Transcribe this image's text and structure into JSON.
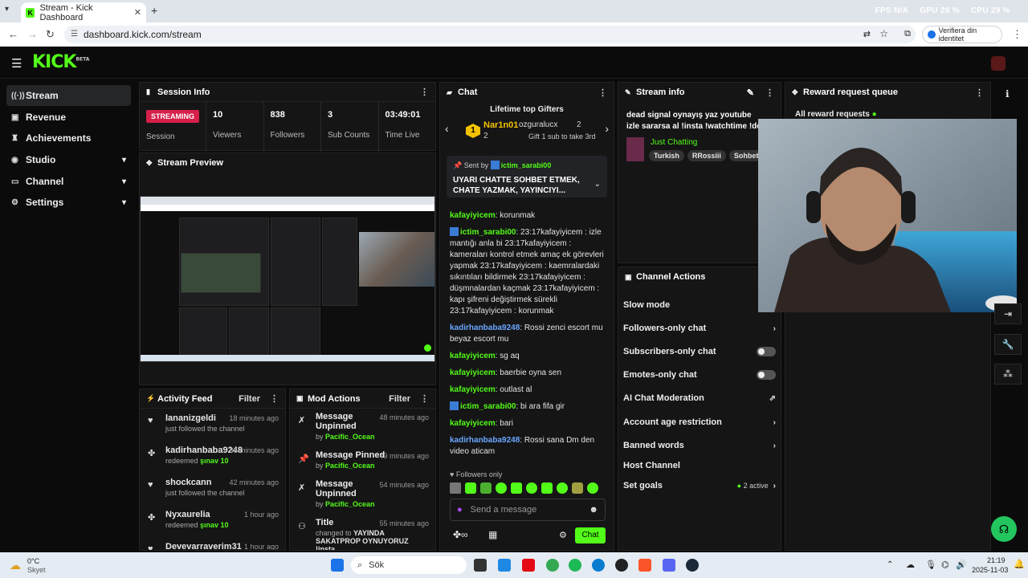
{
  "browser": {
    "tab_title": "Stream - Kick Dashboard",
    "url": "dashboard.kick.com/stream",
    "profile_label": "Verifiera din identitet",
    "hud": {
      "fps_label": "FPS",
      "fps_value": "N/A",
      "gpu_label": "GPU",
      "gpu_value": "29 %",
      "cpu_label": "CPU",
      "cpu_value": "29 %"
    }
  },
  "brand": {
    "logo": "KICK",
    "logo_sup": "BETA",
    "accent": "#53fc18"
  },
  "sidebar": {
    "items": [
      {
        "label": "Stream",
        "icon": "broadcast-icon"
      },
      {
        "label": "Revenue",
        "icon": "revenue-icon"
      },
      {
        "label": "Achievements",
        "icon": "trophy-icon"
      },
      {
        "label": "Studio",
        "icon": "studio-icon"
      },
      {
        "label": "Channel",
        "icon": "channel-icon"
      },
      {
        "label": "Settings",
        "icon": "gear-icon"
      }
    ]
  },
  "session": {
    "title": "Session Info",
    "status": "STREAMING",
    "status_label": "Session",
    "viewers": "10",
    "viewers_label": "Viewers",
    "followers": "838",
    "followers_label": "Followers",
    "subs": "3",
    "subs_label": "Sub Counts",
    "time": "03:49:01",
    "time_label": "Time Live"
  },
  "preview": {
    "title": "Stream Preview"
  },
  "activity": {
    "title": "Activity Feed",
    "filter": "Filter",
    "items": [
      {
        "name": "lananizgeldi",
        "text": "just followed the channel",
        "reward": "",
        "time": "18 minutes ago",
        "icon": "heart-icon"
      },
      {
        "name": "kadirhanbaba9248",
        "text": "redeemed ",
        "reward": "şınav 10",
        "time": "36 minutes ago",
        "icon": "reward-icon"
      },
      {
        "name": "shockcann",
        "text": "just followed the channel",
        "reward": "",
        "time": "42 minutes ago",
        "icon": "heart-icon"
      },
      {
        "name": "Nyxaurelia",
        "text": "redeemed ",
        "reward": "şınav 10",
        "time": "1 hour ago",
        "icon": "reward-icon"
      },
      {
        "name": "Devevarraverim31",
        "text": "",
        "reward": "",
        "time": "1 hour ago",
        "icon": "heart-icon"
      }
    ]
  },
  "mod": {
    "title": "Mod Actions",
    "filter": "Filter",
    "items": [
      {
        "name": "Message Unpinned",
        "by": "by ",
        "who": "Pacific_Ocean",
        "time": "48 minutes ago"
      },
      {
        "name": "Message Pinned",
        "by": "by ",
        "who": "Pacific_Ocean",
        "time": "49 minutes ago"
      },
      {
        "name": "Message Unpinned",
        "by": "by ",
        "who": "Pacific_Ocean",
        "time": "54 minutes ago"
      },
      {
        "name": "Title",
        "by": "changed to ",
        "who": "YAYINDA SAKATPROP OYNUYORUZ !insta",
        "time": "55 minutes ago"
      }
    ]
  },
  "chat": {
    "title": "Chat",
    "gifters_title": "Lifetime top Gifters",
    "gifter1": {
      "rank": "1",
      "name": "Nar1n01",
      "count": "2"
    },
    "gifter2": {
      "name": "ozguralucx",
      "count": "2"
    },
    "gift_cta": "Gift 1 sub to take 3rd",
    "pinned_by_label": "Sent by",
    "pinned_by": "ictim_sarabi00",
    "pinned_text": "UYARI CHATTE SOHBET ETMEK, CHATE YAZMAK, YAYINCIYI...",
    "messages": [
      {
        "user": "kafayiyicem",
        "cls": "u1",
        "bot": false,
        "text": ": korunmak"
      },
      {
        "user": "ictim_sarabi00",
        "cls": "u1",
        "bot": true,
        "text": ": 23:17kafayiyicem : izle mantığı anla bi 23:17kafayiyicem : kameraları kontrol etmek amaç ek görevleri yapmak 23:17kafayiyicem : kaemralardaki sıkıntıları bildirmek 23:17kafayiyicem : düşmnalardan kaçmak 23:17kafayiyicem : kapı şifreni değiştirmek sürekli 23:17kafayiyicem : korunmak"
      },
      {
        "user": "kadirhanbaba9248",
        "cls": "u2",
        "bot": false,
        "text": ": Rossi zenci escort mu beyaz escort mu"
      },
      {
        "user": "kafayiyicem",
        "cls": "u1",
        "bot": false,
        "text": ": sg aq"
      },
      {
        "user": "kafayiyicem",
        "cls": "u1",
        "bot": false,
        "text": ": baerbie oyna sen"
      },
      {
        "user": "kafayiyicem",
        "cls": "u1",
        "bot": false,
        "text": ": outlast al"
      },
      {
        "user": "ictim_sarabi00",
        "cls": "u1",
        "bot": true,
        "text": ": bi ara fifa gir"
      },
      {
        "user": "kafayiyicem",
        "cls": "u1",
        "bot": false,
        "text": ": bari"
      },
      {
        "user": "kadirhanbaba9248",
        "cls": "u2",
        "bot": false,
        "text": ": Rossi sana Dm den video aticam"
      }
    ],
    "followers_only": "Followers only",
    "placeholder": "Send a message",
    "send": "Chat"
  },
  "stream_info": {
    "title": "Stream info",
    "stream_title": "dead signal oynayış yaz youtube izle sararsa al !insta !watchtime !dc",
    "category": "Just Chatting",
    "tags": [
      "Turkish",
      "RRossiii",
      "Sohbet"
    ]
  },
  "channel_actions": {
    "title": "Channel Actions",
    "items": [
      {
        "label": "Slow mode",
        "kind": "none",
        "extra": ""
      },
      {
        "label": "Followers-only chat",
        "kind": "chev",
        "extra": ""
      },
      {
        "label": "Subscribers-only chat",
        "kind": "toggle",
        "extra": ""
      },
      {
        "label": "Emotes-only chat",
        "kind": "toggle",
        "extra": ""
      },
      {
        "label": "AI Chat Moderation",
        "kind": "ext",
        "extra": ""
      },
      {
        "label": "Account age restriction",
        "kind": "chev",
        "extra": ""
      },
      {
        "label": "Banned words",
        "kind": "chev",
        "extra": ""
      },
      {
        "label": "Host Channel",
        "kind": "none",
        "extra": ""
      },
      {
        "label": "Set goals",
        "kind": "chev",
        "extra": "2 active"
      }
    ]
  },
  "rewards": {
    "title": "Reward request queue",
    "filter": "All reward requests"
  },
  "taskbar": {
    "weather_temp": "0°C",
    "weather_text": "Skyet",
    "search": "Sök",
    "time": "21:19",
    "date": "2025-11-03"
  }
}
